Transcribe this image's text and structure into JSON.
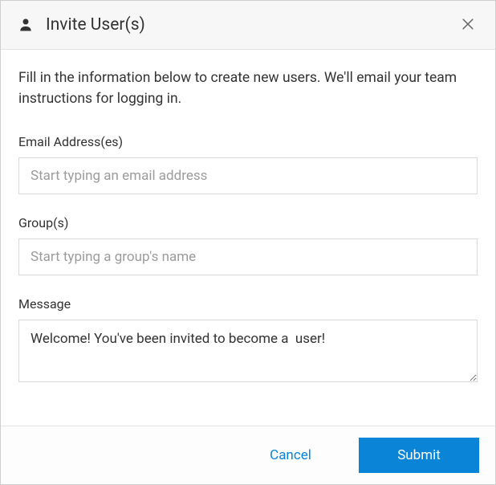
{
  "header": {
    "title": "Invite User(s)"
  },
  "body": {
    "intro": "Fill in the information below to create new users. We'll email your team instructions for logging in."
  },
  "form": {
    "email": {
      "label": "Email Address(es)",
      "placeholder": "Start typing an email address",
      "value": ""
    },
    "groups": {
      "label": "Group(s)",
      "placeholder": "Start typing a group's name",
      "value": ""
    },
    "message": {
      "label": "Message",
      "value": "Welcome! You've been invited to become a  user!"
    }
  },
  "footer": {
    "cancel_label": "Cancel",
    "submit_label": "Submit"
  }
}
